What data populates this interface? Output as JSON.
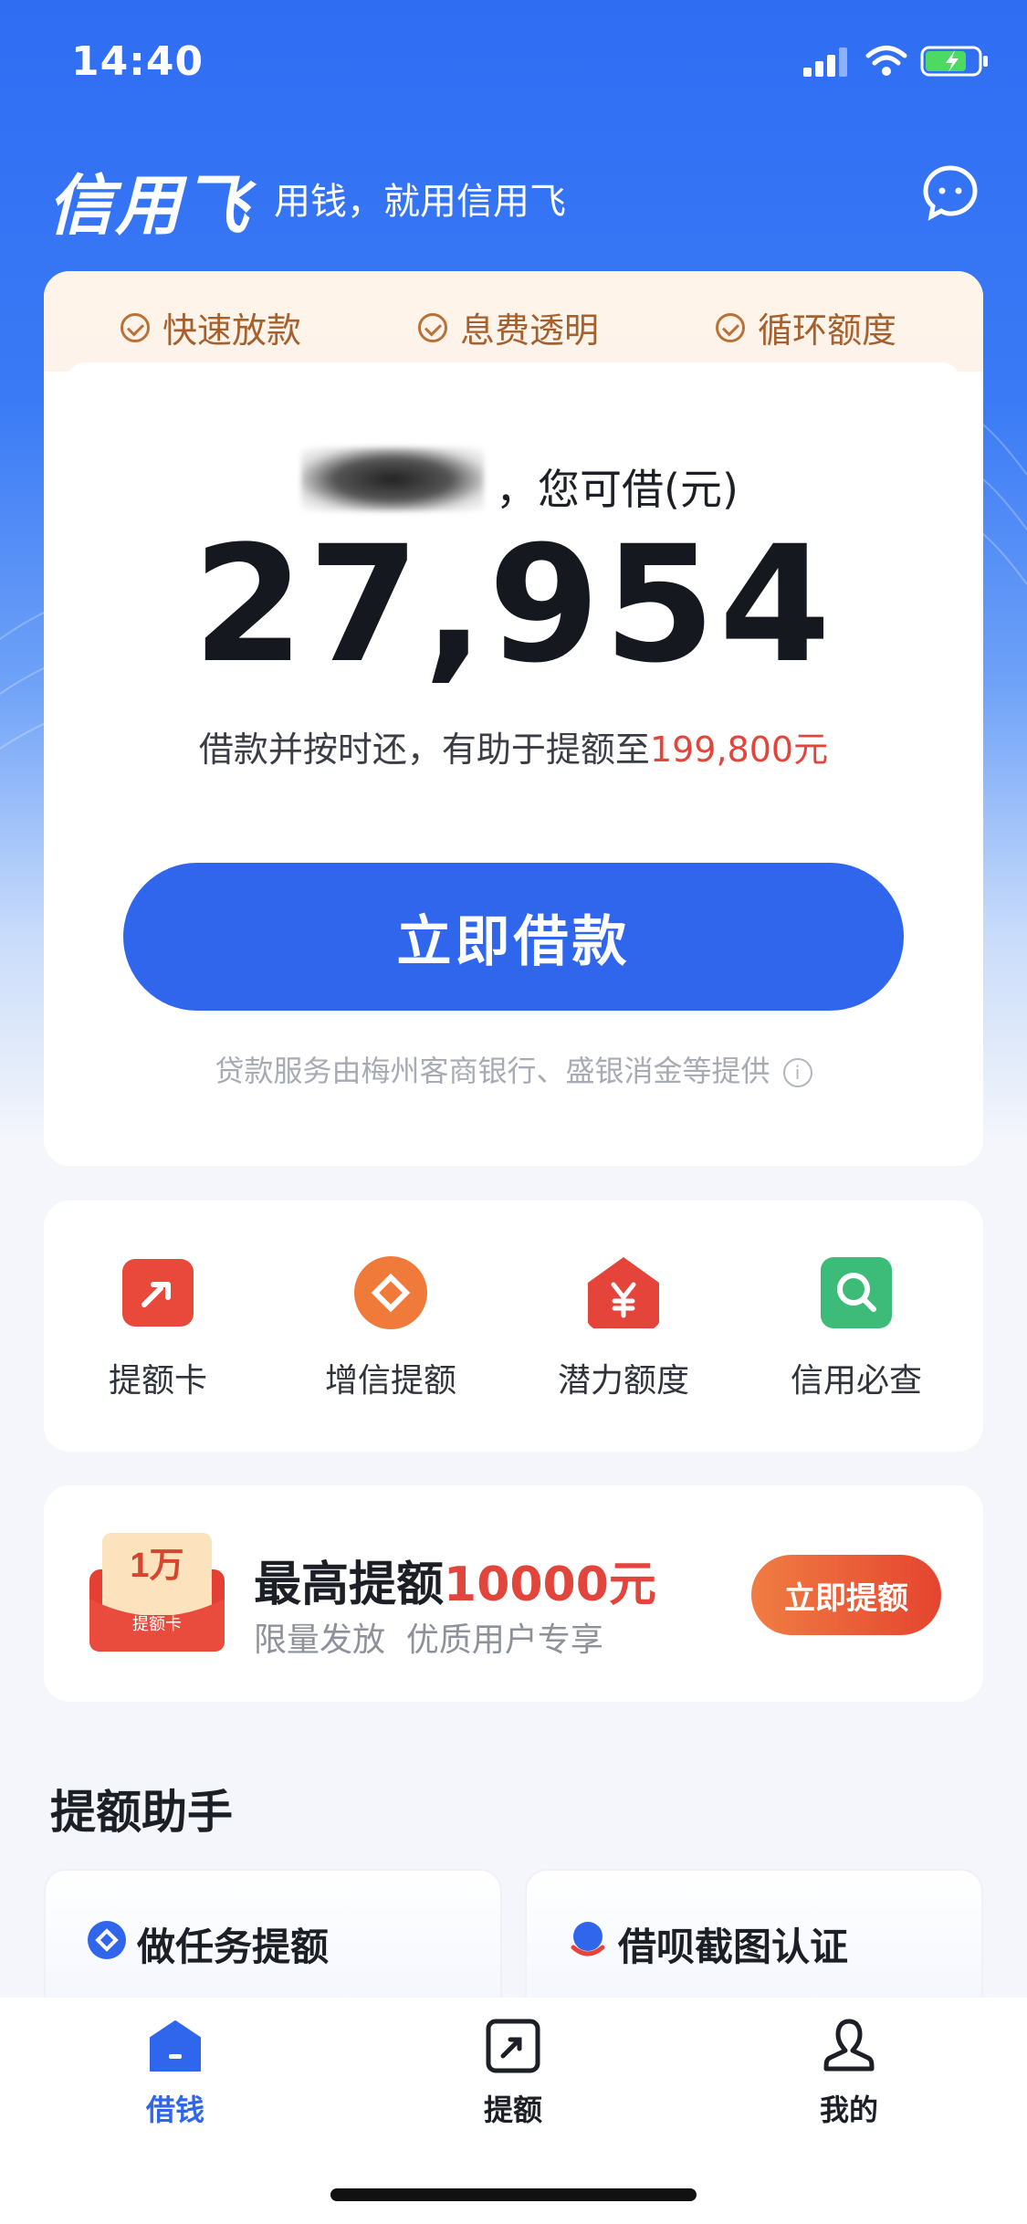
{
  "status_bar": {
    "time": "14:40"
  },
  "header": {
    "brand": "信用飞",
    "slogan": "用钱，就用信用飞",
    "message_icon": "chat-bubble-icon"
  },
  "main_card": {
    "features": [
      "快速放款",
      "息费透明",
      "循环额度"
    ],
    "can_borrow_label": "，您可借(元)",
    "amount": "27,954",
    "hint_prefix": "借款并按时还，有助于提额至",
    "hint_amount": "199,800元",
    "borrow_button": "立即借款",
    "provider_note": "贷款服务由梅州客商银行、盛银消金等提供",
    "info_icon": "info-icon"
  },
  "shortcuts": [
    {
      "label": "提额卡",
      "icon": "card-arrow-icon",
      "color": "#e9493a"
    },
    {
      "label": "增信提额",
      "icon": "diamond-coin-icon",
      "color": "#f07a3a"
    },
    {
      "label": "潜力额度",
      "icon": "yen-house-icon",
      "color": "#e4443a"
    },
    {
      "label": "信用必查",
      "icon": "search-icon",
      "color": "#3dbb78"
    }
  ],
  "promo": {
    "envelope_amount": "1万",
    "envelope_label": "提额卡",
    "title_prefix": "最高提额",
    "title_amount": "10000元",
    "subtitle": "限量发放  优质用户专享",
    "button": "立即提额"
  },
  "assistant": {
    "title": "提额助手",
    "items": [
      {
        "label": "做任务提额",
        "icon": "task-diamond-icon"
      },
      {
        "label": "借呗截图认证",
        "icon": "jiebei-icon"
      }
    ]
  },
  "tabbar": [
    {
      "label": "借钱",
      "icon": "home-icon",
      "active": true
    },
    {
      "label": "提额",
      "icon": "quota-icon",
      "active": false
    },
    {
      "label": "我的",
      "icon": "profile-icon",
      "active": false
    }
  ],
  "colors": {
    "primary": "#2f66ec",
    "accent_red": "#e2453b",
    "feature_brown": "#a5602d"
  }
}
